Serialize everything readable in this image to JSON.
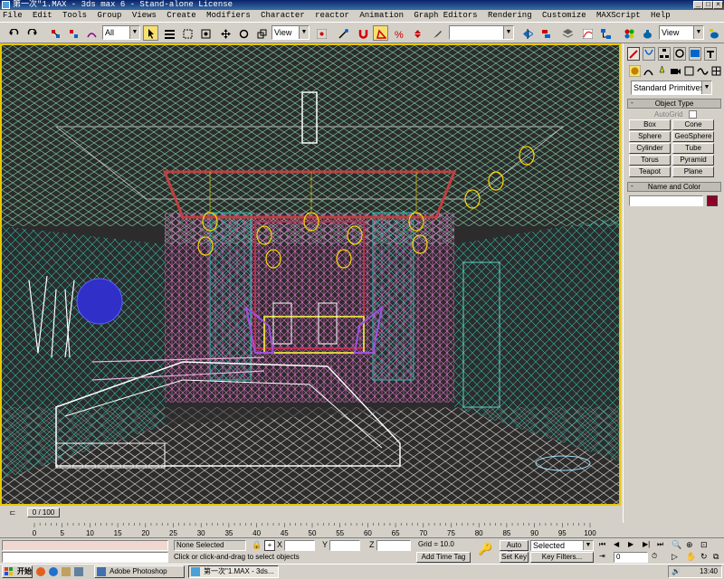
{
  "window": {
    "title": "第一次\"1.MAX - 3ds max 6 - Stand-alone License",
    "minimize": "_",
    "maximize": "□",
    "close": "×"
  },
  "menu": [
    "File",
    "Edit",
    "Tools",
    "Group",
    "Views",
    "Create",
    "Modifiers",
    "Character",
    "reactor",
    "Animation",
    "Graph Editors",
    "Rendering",
    "Customize",
    "MAXScript",
    "Help"
  ],
  "toolbar": {
    "selection_filter": "All",
    "reference_coord": "View",
    "named_selection": "",
    "render_view": "View"
  },
  "colors": {
    "active_viewport_border": "#e8c800",
    "title_bar": "#0a246a",
    "object_color_swatch": "#8b0028",
    "highlight_button": "#f5e070"
  },
  "command_panel": {
    "category": "Standard Primitives",
    "object_type_header": "Object Type",
    "autogrid_label": "AutoGrid",
    "primitives": [
      "Box",
      "Cone",
      "Sphere",
      "GeoSphere",
      "Cylinder",
      "Tube",
      "Torus",
      "Pyramid",
      "Teapot",
      "Plane"
    ],
    "name_color_header": "Name and Color",
    "name_value": ""
  },
  "timeline": {
    "slider_label": "0 / 100",
    "ticks": [
      "0",
      "5",
      "10",
      "15",
      "20",
      "25",
      "30",
      "35",
      "40",
      "45",
      "50",
      "55",
      "60",
      "65",
      "70",
      "75",
      "80",
      "85",
      "90",
      "95",
      "100"
    ]
  },
  "status": {
    "selection": "None Selected",
    "prompt": "Click or click-and-drag to select objects",
    "x_label": "X",
    "y_label": "Y",
    "z_label": "Z",
    "x_value": "",
    "y_value": "",
    "z_value": "",
    "grid": "Grid = 10.0",
    "add_time_tag": "Add Time Tag",
    "auto_key": "Auto Key",
    "set_key": "Set Key",
    "key_mode": "Selected",
    "key_filters": "Key Filters...",
    "frame": "0"
  },
  "taskbar": {
    "start": "开始",
    "tasks": [
      "Adobe Photoshop",
      "第一次\"1.MAX - 3ds..."
    ],
    "clock": "13:40"
  }
}
